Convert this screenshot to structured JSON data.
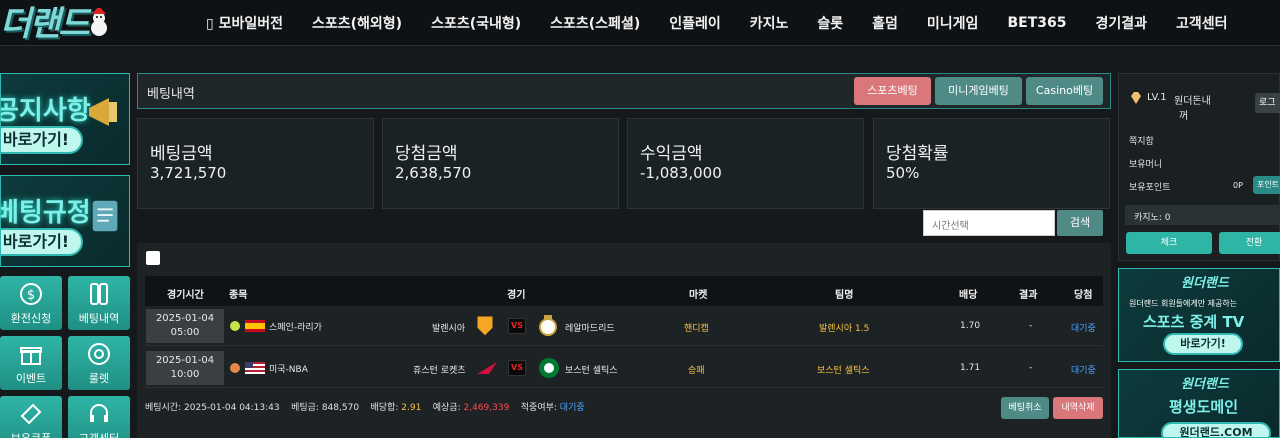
{
  "brand": {
    "logo_text": "더랜드"
  },
  "nav": {
    "items": [
      "▯ 모바일버전",
      "스포츠(해외형)",
      "스포츠(국내형)",
      "스포츠(스페셜)",
      "인플레이",
      "카지노",
      "슬롯",
      "홀덤",
      "미니게임",
      "BET365",
      "경기결과",
      "고객센터"
    ]
  },
  "left": {
    "banner1": {
      "title": "공지사항",
      "button": "바로가기!"
    },
    "banner2": {
      "title": "베팅규정",
      "button": "바로가기!"
    },
    "tiles": [
      {
        "label": "환전신청",
        "icon": "coin-icon"
      },
      {
        "label": "베팅내역",
        "icon": "betslip-icon"
      },
      {
        "label": "이벤트",
        "icon": "gift-icon"
      },
      {
        "label": "룰렛",
        "icon": "roulette-icon"
      },
      {
        "label": "보유쿠폰",
        "icon": "coupon-icon"
      },
      {
        "label": "고객센터",
        "icon": "headset-icon"
      }
    ]
  },
  "main": {
    "title": "베팅내역",
    "tabs": [
      {
        "label": "스포츠베팅",
        "color": "#d9777a"
      },
      {
        "label": "미니게임베팅",
        "color": "#4f8a87"
      },
      {
        "label": "Casino베팅",
        "color": "#4f8a87"
      }
    ],
    "stats": [
      {
        "label": "베팅금액",
        "value": "3,721,570"
      },
      {
        "label": "당첨금액",
        "value": "2,638,570"
      },
      {
        "label": "수익금액",
        "value": "-1,083,000"
      },
      {
        "label": "당첨확률",
        "value": "50%"
      }
    ],
    "search": {
      "placeholder": "시간선택",
      "button": "검색"
    },
    "table": {
      "headers": [
        "경기시간",
        "종목",
        "경기",
        "마켓",
        "팀명",
        "배당",
        "결과",
        "당첨"
      ],
      "rows": [
        {
          "date": "2025-01-04",
          "time": "05:00",
          "league": "스페인-라리가",
          "home": "발렌시아",
          "away": "레알마드리드",
          "market": "핸디캡",
          "pick": "발렌시아 1.5",
          "odds": "1.70",
          "result": "-",
          "status": "대기중"
        },
        {
          "date": "2025-01-04",
          "time": "10:00",
          "league": "미국-NBA",
          "home": "휴스턴 로켓츠",
          "away": "보스턴 셀틱스",
          "market": "승패",
          "pick": "보스턴 셀틱스",
          "odds": "1.71",
          "result": "-",
          "status": "대기중"
        }
      ]
    },
    "summary": {
      "bet_time_label": "베팅시간:",
      "bet_time": "2025-01-04 04:13:43",
      "bet_amount_label": "베팅금:",
      "bet_amount": "848,570",
      "odds_sum_label": "배당합:",
      "odds_sum": "2.91",
      "expected_label": "예상금:",
      "expected": "2,469,339",
      "hit_label": "적중여부:",
      "hit": "대기중",
      "cancel_button": "베팅취소",
      "delete_button": "내역삭제"
    }
  },
  "user": {
    "level": "LV.1",
    "name_line1": "원더돈내",
    "name_line2": "꺼",
    "logout_button": "로그",
    "notes_label": "쪽지함",
    "money_label": "보유머니",
    "points_label": "보유포인트",
    "points_value": "0P",
    "points_button": "포인트",
    "casino_label": "카지노: 0",
    "charge_button": "체크",
    "exchange_button": "전환"
  },
  "right_banners": [
    {
      "brand": "원더랜드",
      "line1": "원더랜드 회원들에게만 제공하는",
      "line2": "스포츠 중계 TV",
      "button": "바로가기!"
    },
    {
      "brand": "원더랜드",
      "line1": "평생도메인",
      "line2": "원더랜드.COM"
    }
  ]
}
